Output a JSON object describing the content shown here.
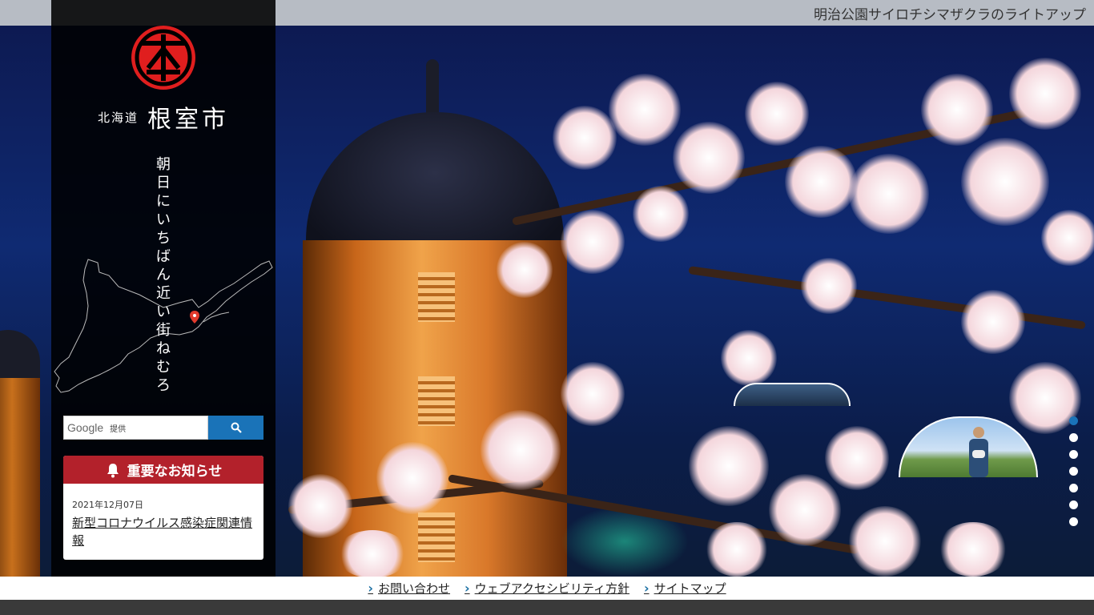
{
  "topbar": {
    "caption": "明治公園サイロチシマザクラのライトアップ"
  },
  "sidebar": {
    "pref": "北海道",
    "city": "根室市",
    "slogan_line1": "朝日にいちばん近い街",
    "slogan_line2": "ねむろ"
  },
  "search": {
    "provider": "Google",
    "provided_by": "提供"
  },
  "notice": {
    "heading": "重要なお知らせ",
    "date": "2021年12月07日",
    "link_text": "新型コロナウイルス感染症関連情報"
  },
  "slider": {
    "dot_count": 7,
    "active_index": 0
  },
  "footer": {
    "links": [
      "お問い合わせ",
      "ウェブアクセシビリティ方針",
      "サイトマップ"
    ]
  },
  "colors": {
    "accent_red": "#b3212b",
    "accent_blue": "#1a73b8"
  },
  "icons": {
    "search": "search-icon",
    "bell": "bell-icon",
    "chevron": "chevron-right-icon",
    "map_pin": "map-pin-icon"
  }
}
